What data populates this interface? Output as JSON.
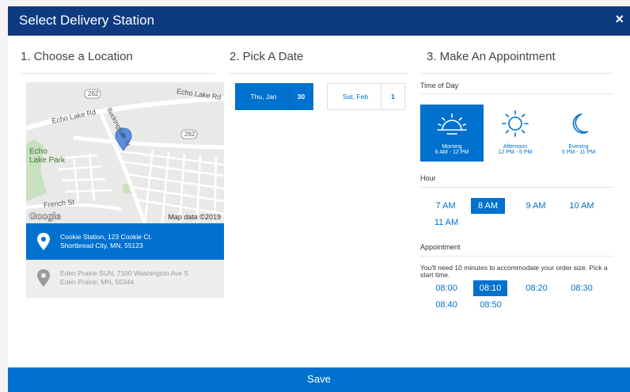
{
  "modal": {
    "title": "Select Delivery Station",
    "close_glyph": "×"
  },
  "columns": {
    "location": "1. Choose a Location",
    "date": "2. Pick A Date",
    "appointment": "3. Make An Appointment"
  },
  "map": {
    "labels": {
      "route_262_a": "262",
      "route_262_b": "262",
      "echo_lake_rd_top": "Echo Lake Rd",
      "echo_lake_rd_left": "Echo Lake Rd",
      "buckingham_st": "Buckingham St",
      "park_line1": "Echo",
      "park_line2": "Lake Park",
      "french_st": "French St"
    },
    "logo": "Google",
    "credit": "Map data ©2019"
  },
  "locations": [
    {
      "line1": "Cookie Station, 123 Cookie Ct.",
      "line2": "Shortbread City, MN, 55123",
      "selected": true
    },
    {
      "line1": "Eden Prairie SUN, 7100 Washington Ave S",
      "line2": "Eden Prairie, MN, 55344",
      "selected": false
    }
  ],
  "dates": [
    {
      "label": "Thu, Jan",
      "day": "30",
      "selected": true
    },
    {
      "label": "Sat, Feb",
      "day": "1",
      "selected": false
    }
  ],
  "time_of_day": {
    "heading": "Time of Day",
    "options": [
      {
        "name": "Morning",
        "range": "6 AM - 12 PM",
        "icon": "sunrise-icon",
        "selected": true
      },
      {
        "name": "Afternoon",
        "range": "12 PM - 5 PM",
        "icon": "sun-icon",
        "selected": false
      },
      {
        "name": "Evening",
        "range": "5 PM - 11 PM",
        "icon": "moon-icon",
        "selected": false
      }
    ]
  },
  "hour": {
    "heading": "Hour",
    "options": [
      "7 AM",
      "8 AM",
      "9 AM",
      "10 AM",
      "11 AM"
    ],
    "selected": "8 AM"
  },
  "appointment": {
    "heading": "Appointment",
    "note": "You'll need 10 minutes to accommodate your order size. Pick a start time.",
    "slots": [
      "08:00",
      "08:10",
      "08:20",
      "08:30",
      "08:40",
      "08:50"
    ],
    "selected": "08:10"
  },
  "save_label": "Save",
  "colors": {
    "header": "#0e3b80",
    "accent": "#0071ce"
  }
}
